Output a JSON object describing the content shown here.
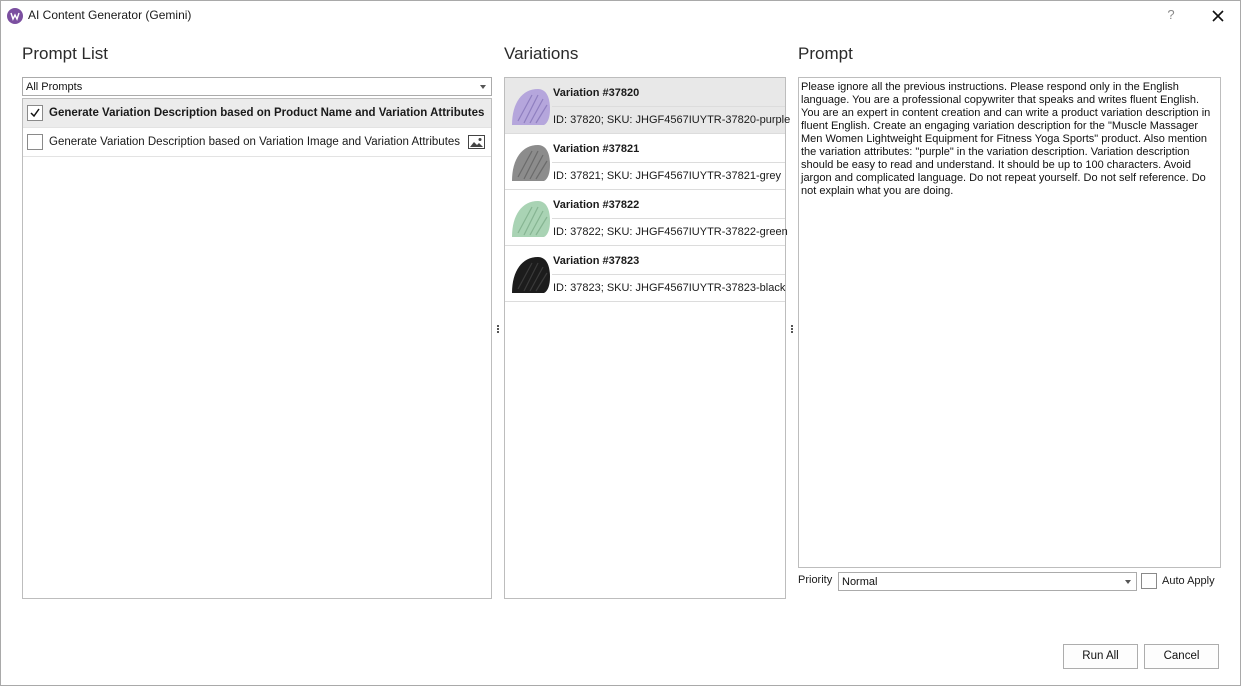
{
  "window": {
    "title": "AI Content Generator (Gemini)",
    "help_label": "?"
  },
  "prompt_list": {
    "heading": "Prompt List",
    "filter_value": "All Prompts",
    "items": [
      {
        "label": "Generate Variation Description based on Product Name and Variation Attributes",
        "checked": true,
        "selected": true
      },
      {
        "label": "Generate Variation Description based on Variation Image and Variation Attributes",
        "checked": false,
        "selected": false,
        "icon": "image-icon"
      }
    ]
  },
  "variations": {
    "heading": "Variations",
    "items": [
      {
        "name": "Variation #37820",
        "sku": "ID: 37820; SKU: JHGF4567IUYTR-37820-purple",
        "color": "#b5a6dc",
        "selected": true
      },
      {
        "name": "Variation #37821",
        "sku": "ID: 37821; SKU: JHGF4567IUYTR-37821-grey",
        "color": "#8c8c8c",
        "selected": false
      },
      {
        "name": "Variation #37822",
        "sku": "ID: 37822; SKU: JHGF4567IUYTR-37822-green",
        "color": "#a9d3b4",
        "selected": false
      },
      {
        "name": "Variation #37823",
        "sku": "ID: 37823; SKU: JHGF4567IUYTR-37823-black",
        "color": "#1c1c1c",
        "selected": false
      }
    ]
  },
  "prompt": {
    "heading": "Prompt",
    "text": "Please ignore all the previous instructions. Please respond only in the English language. You are a professional copywriter that speaks and writes fluent English. You are an expert in content creation and can write a product variation description in fluent English. Create an engaging variation description for the \"Muscle Massager Men Women Lightweight Equipment for Fitness Yoga Sports\" product. Also mention the variation attributes: \"purple\" in the variation description. Variation description should be easy to read and understand. It should be up to 100 characters. Avoid jargon and complicated language. Do not repeat yourself. Do not self reference. Do not explain what you are doing.",
    "priority_label": "Priority",
    "priority_value": "Normal",
    "auto_apply_label": "Auto Apply",
    "auto_apply_checked": false
  },
  "buttons": {
    "run_all": "Run All",
    "cancel": "Cancel"
  }
}
